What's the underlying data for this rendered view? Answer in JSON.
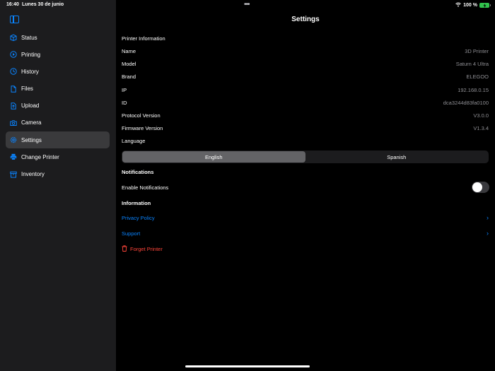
{
  "status_bar": {
    "time": "16:40",
    "date": "Lunes 30 de junio",
    "battery": "100 %"
  },
  "sidebar": {
    "items": [
      {
        "label": "Status",
        "icon": "status-icon"
      },
      {
        "label": "Printing",
        "icon": "play-circle-icon"
      },
      {
        "label": "History",
        "icon": "clock-icon"
      },
      {
        "label": "Files",
        "icon": "document-icon"
      },
      {
        "label": "Upload",
        "icon": "upload-icon"
      },
      {
        "label": "Camera",
        "icon": "camera-icon"
      },
      {
        "label": "Settings",
        "icon": "gear-icon",
        "active": true
      },
      {
        "label": "Change Printer",
        "icon": "printer-icon"
      },
      {
        "label": "Inventory",
        "icon": "archive-box-icon"
      }
    ]
  },
  "main": {
    "title": "Settings",
    "printer_info_header": "Printer Information",
    "rows": [
      {
        "label": "Name",
        "value": "3D Printer"
      },
      {
        "label": "Model",
        "value": "Saturn 4 Ultra"
      },
      {
        "label": "Brand",
        "value": "ELEGOO"
      },
      {
        "label": "IP",
        "value": "192.168.0.15"
      },
      {
        "label": "ID",
        "value": "dca3244d83fa0100"
      },
      {
        "label": "Protocol Version",
        "value": "V3.0.0"
      },
      {
        "label": "Firmware Version",
        "value": "V1.3.4"
      }
    ],
    "language_label": "Language",
    "language_options": [
      "English",
      "Spanish"
    ],
    "language_selected": "English",
    "notifications_header": "Notifications",
    "enable_notifications_label": "Enable Notifications",
    "notifications_enabled": false,
    "information_header": "Information",
    "privacy_policy": "Privacy Policy",
    "support": "Support",
    "forget_printer": "Forget Printer"
  },
  "colors": {
    "accent": "#0a84ff",
    "destructive": "#ff453a",
    "sidebar_bg": "#1c1c1e",
    "active_item_bg": "#3a3a3c"
  }
}
